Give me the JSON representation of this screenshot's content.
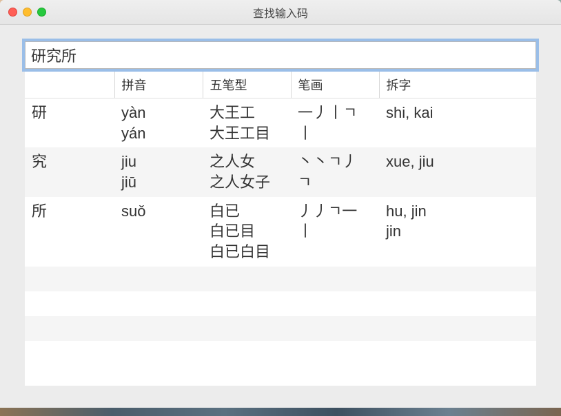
{
  "window": {
    "title": "查找输入码"
  },
  "search": {
    "value": "研究所"
  },
  "table": {
    "headers": {
      "char": "",
      "pinyin": "拼音",
      "wubi": "五笔型",
      "stroke": "笔画",
      "chaizi": "拆字"
    },
    "rows": [
      {
        "char": "研",
        "pinyin": "yàn\nyán",
        "wubi": "大王工\n大王工目",
        "stroke": "一丿丨ㄱ\n丨",
        "chaizi": "shi, kai"
      },
      {
        "char": "究",
        "pinyin": "jiu\njiū",
        "wubi": "之人女\n之人女子",
        "stroke": "丶丶ㄱ丿\nㄱ",
        "chaizi": "xue, jiu"
      },
      {
        "char": "所",
        "pinyin": "suǒ",
        "wubi": "白已\n白已目\n白已白目",
        "stroke": "丿丿ㄱ一\n丨",
        "chaizi": "hu, jin\njin"
      }
    ]
  }
}
